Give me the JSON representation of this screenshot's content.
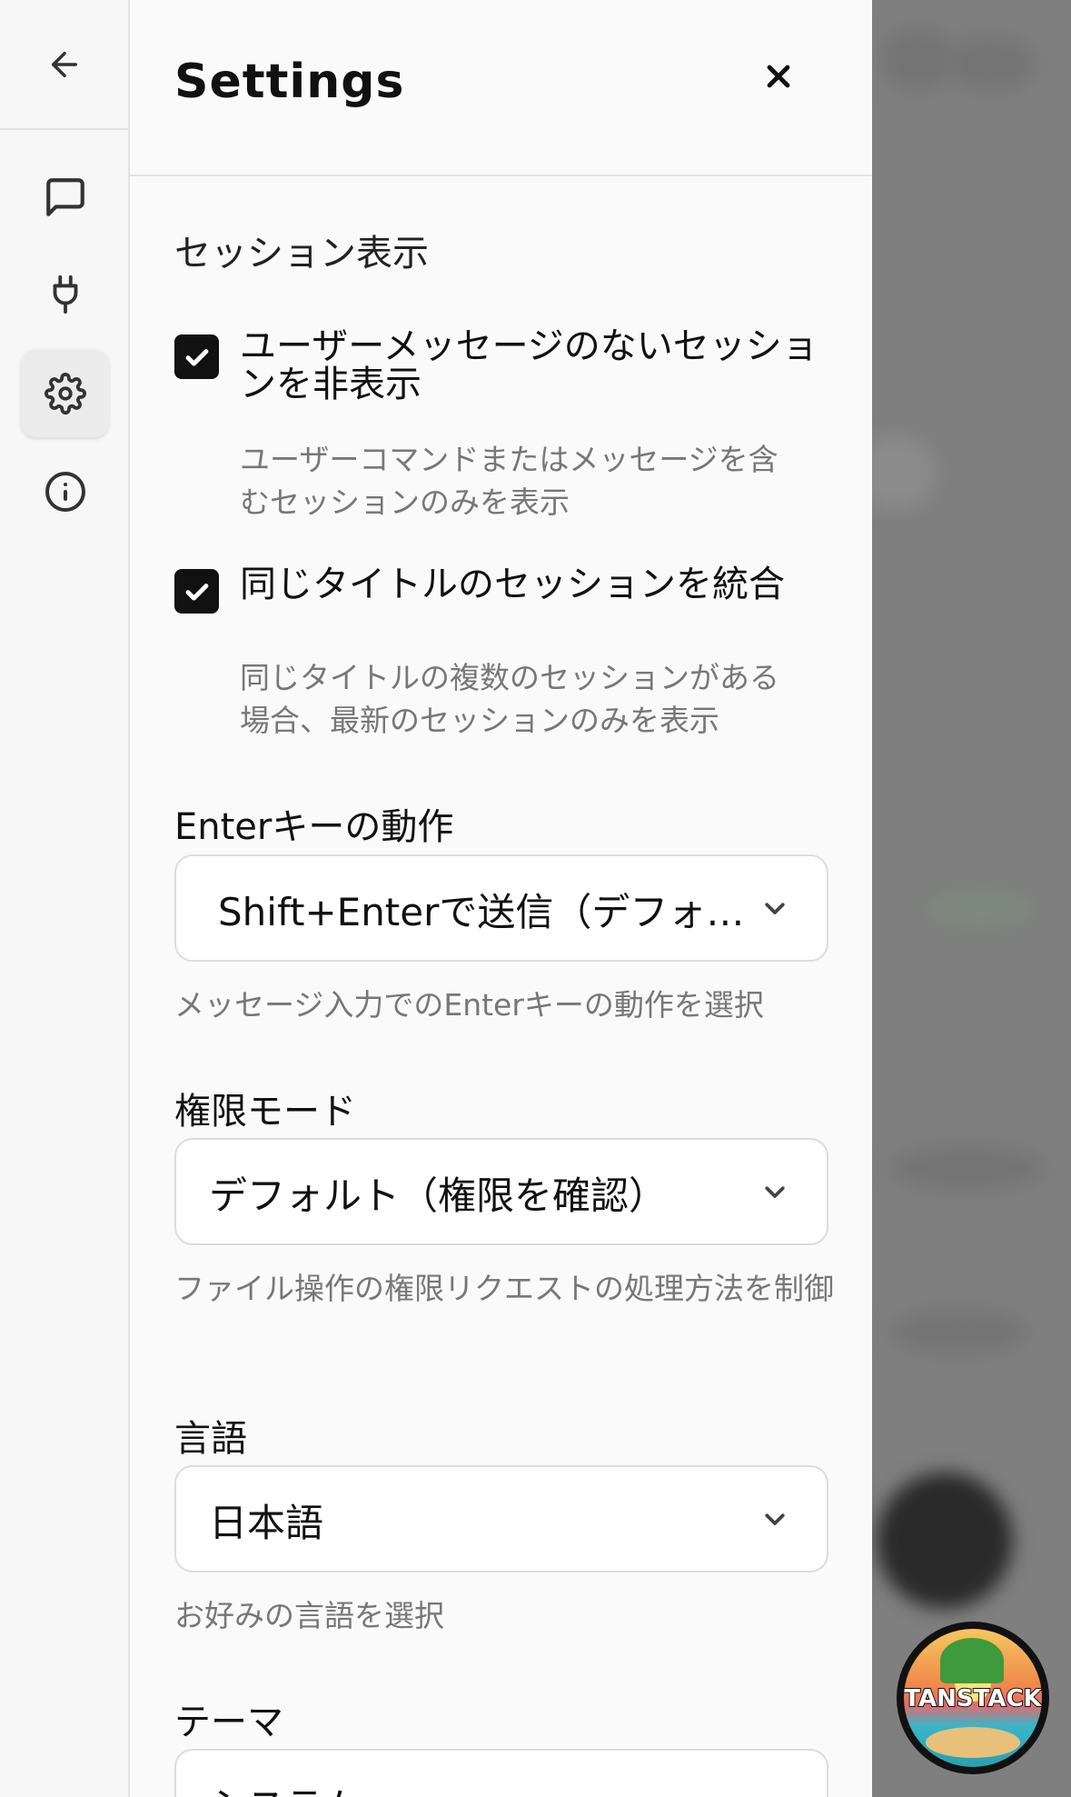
{
  "settings": {
    "title": "Settings",
    "sections": {
      "session_display": {
        "title": "セッション表示",
        "hide_no_user_message": {
          "label": "ユーザーメッセージのないセッションを非表示",
          "checked": true,
          "description": "ユーザーコマンドまたはメッセージを含むセッションのみを表示"
        },
        "merge_same_title": {
          "label": "同じタイトルのセッションを統合",
          "checked": true,
          "description": "同じタイトルの複数のセッションがある場合、最新のセッションのみを表示"
        }
      },
      "enter_key": {
        "label": "Enterキーの動作",
        "value": "Shift+Enterで送信（デフォ…",
        "helper": "メッセージ入力でのEnterキーの動作を選択"
      },
      "permission_mode": {
        "label": "権限モード",
        "value": "デフォルト（権限を確認）",
        "helper": "ファイル操作の権限リクエストの処理方法を制御"
      },
      "language": {
        "label": "言語",
        "value": "日本語",
        "helper": "お好みの言語を選択"
      },
      "theme": {
        "label": "テーマ",
        "value": "システム"
      }
    }
  },
  "rail": {
    "items": [
      {
        "icon": "arrow-left-icon"
      },
      {
        "icon": "message-square-icon"
      },
      {
        "icon": "plug-icon"
      },
      {
        "icon": "gear-icon",
        "active": true
      },
      {
        "icon": "info-icon"
      }
    ]
  },
  "floating_badge": {
    "text": "TANSTACK"
  },
  "colors": {
    "panel_bg": "#fafafa",
    "overlay": "#7f7f7f",
    "checkbox": "#111111",
    "muted_text": "#777777"
  }
}
